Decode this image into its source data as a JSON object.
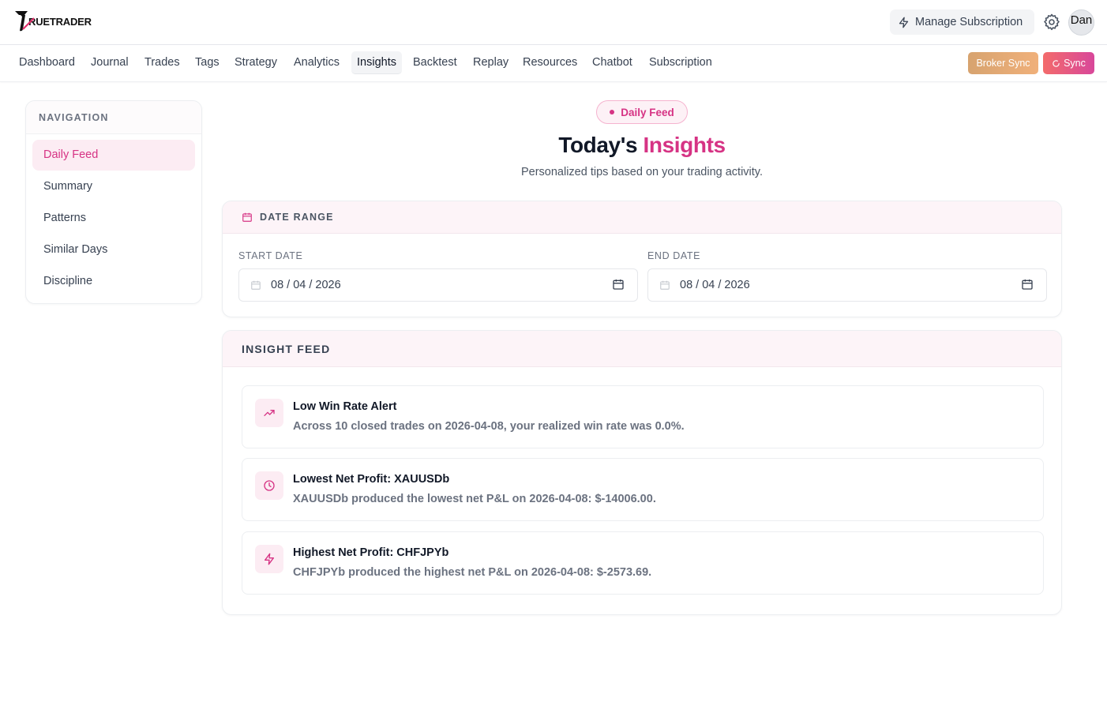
{
  "app": {
    "logo_text": "RUETRADER"
  },
  "header": {
    "manage_subscription": "Manage Subscription",
    "user_initials": "Dan"
  },
  "nav": {
    "tabs": [
      "Dashboard",
      "Journal",
      "Trades",
      "Tags",
      "Strategy",
      "Analytics",
      "Insights",
      "Backtest",
      "Replay",
      "Resources",
      "Chatbot",
      "Subscription"
    ],
    "active": "Insights",
    "broker_sync": "Broker Sync",
    "sync": "Sync"
  },
  "sidebar": {
    "heading": "NAVIGATION",
    "items": [
      "Daily Feed",
      "Summary",
      "Patterns",
      "Similar Days",
      "Discipline"
    ],
    "active": "Daily Feed"
  },
  "page": {
    "badge": "Daily Feed",
    "title_prefix": "Today's",
    "title_accent": "Insights",
    "subtitle": "Personalized tips based on your trading activity."
  },
  "date_range": {
    "heading": "DATE RANGE",
    "start_label": "START DATE",
    "start_value": "08 / 04 / 2026",
    "end_label": "END DATE",
    "end_value": "08 / 04 / 2026"
  },
  "insight_feed": {
    "heading": "INSIGHT FEED",
    "items": [
      {
        "icon": "trending-up-icon",
        "title": "Low Win Rate Alert",
        "description": "Across 10 closed trades on 2026-04-08, your realized win rate was 0.0%."
      },
      {
        "icon": "clock-icon",
        "title": "Lowest Net Profit: XAUUSDb",
        "description": "XAUUSDb produced the lowest net P&L on 2026-04-08: $-14006.00."
      },
      {
        "icon": "lightning-icon",
        "title": "Highest Net Profit: CHFJPYb",
        "description": "CHFJPYb produced the highest net P&L on 2026-04-08: $-2573.69."
      }
    ]
  },
  "colors": {
    "accent": "#d63384",
    "accent_soft": "#fcecf3",
    "broker_sync": "#e8a873",
    "sync": "#e85a7e"
  }
}
